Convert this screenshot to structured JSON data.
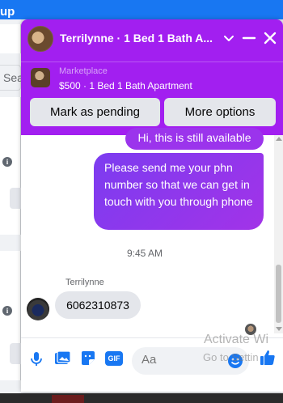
{
  "background": {
    "app_fragment": "up",
    "search_fragment": "Sea"
  },
  "chat": {
    "title": "Terrilynne · 1 Bed 1 Bath A...",
    "marketplace_label": "Marketplace",
    "listing": "$500 · 1 Bed 1 Bath Apartment",
    "buttons": {
      "pending": "Mark as pending",
      "more": "More options"
    },
    "messages": [
      {
        "from": "me",
        "text": "Hi, this is still available"
      },
      {
        "from": "me",
        "text": "Please send me your phn number so that we can get in touch with you through phone"
      }
    ],
    "timestamp": "9:45 AM",
    "incoming": {
      "sender": "Terrilynne",
      "text": "6062310873"
    },
    "composer": {
      "placeholder": "Aa",
      "icons": [
        "microphone-icon",
        "photo-icon",
        "sticker-icon",
        "gif-icon",
        "emoji-icon",
        "like-icon"
      ],
      "gif_label": "GIF"
    },
    "accent_color": "#a21ff0",
    "bubble_color": "#8a37ee"
  },
  "watermark": {
    "line1": "Activate Wi",
    "line2": "Go to Settin"
  }
}
